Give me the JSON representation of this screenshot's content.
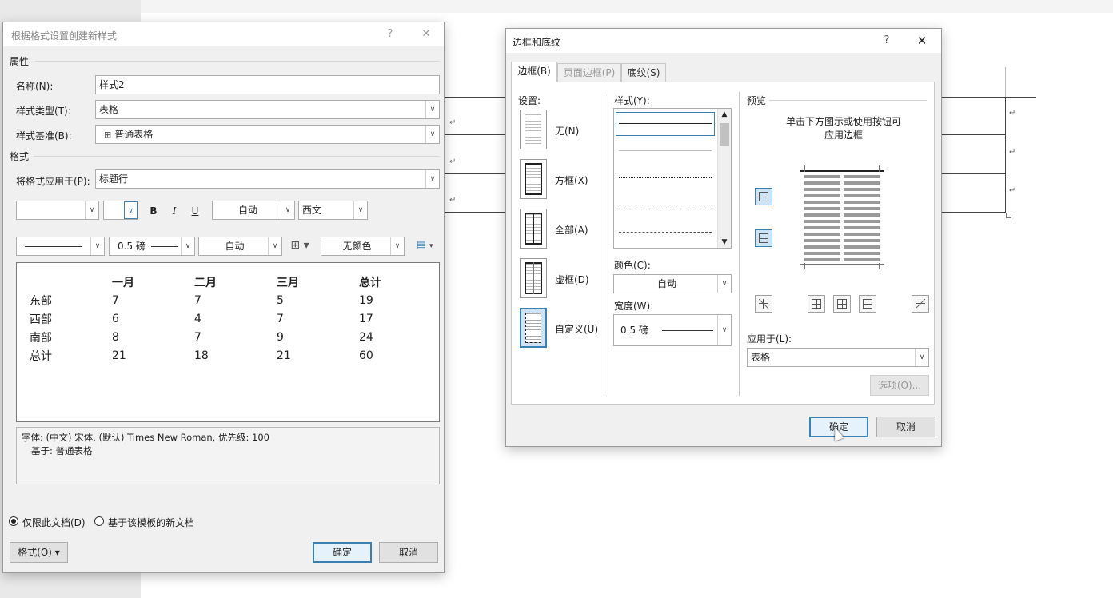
{
  "left_dialog": {
    "title": "根据格式设置创建新样式",
    "help": "?",
    "close": "✕",
    "section_properties": "属性",
    "name_label": "名称(N):",
    "name_value": "样式2",
    "type_label": "样式类型(T):",
    "type_value": "表格",
    "based_label": "样式基准(B):",
    "based_value": "普通表格",
    "section_format": "格式",
    "apply_label": "将格式应用于(P):",
    "apply_value": "标题行",
    "bold": "B",
    "italic": "I",
    "underline": "U",
    "font_color": "自动",
    "script": "西文",
    "border_weight": "0.5 磅",
    "border_color": "自动",
    "shading": "无颜色",
    "preview_table": {
      "headers": [
        "",
        "一月",
        "二月",
        "三月",
        "总计"
      ],
      "rows": [
        [
          "东部",
          "7",
          "7",
          "5",
          "19"
        ],
        [
          "西部",
          "6",
          "4",
          "7",
          "17"
        ],
        [
          "南部",
          "8",
          "7",
          "9",
          "24"
        ],
        [
          "总计",
          "21",
          "18",
          "21",
          "60"
        ]
      ]
    },
    "desc_line1": "字体: (中文) 宋体, (默认) Times New Roman, 优先级: 100",
    "desc_line2": "基于: 普通表格",
    "radio_doc": "仅限此文档(D)",
    "radio_template": "基于该模板的新文档",
    "format_button": "格式(O) ▾",
    "ok": "确定",
    "cancel": "取消"
  },
  "right_dialog": {
    "title": "边框和底纹",
    "help": "?",
    "close": "✕",
    "tabs": [
      "边框(B)",
      "页面边框(P)",
      "底纹(S)"
    ],
    "settings_label": "设置:",
    "settings": [
      "无(N)",
      "方框(X)",
      "全部(A)",
      "虚框(D)",
      "自定义(U)"
    ],
    "style_label": "样式(Y):",
    "color_label": "颜色(C):",
    "color_value": "自动",
    "width_label": "宽度(W):",
    "width_value": "0.5 磅",
    "preview_label": "预览",
    "preview_hint_1": "单击下方图示或使用按钮可",
    "preview_hint_2": "应用边框",
    "apply_label": "应用于(L):",
    "apply_value": "表格",
    "options": "选项(O)...",
    "ok": "确定",
    "cancel": "取消"
  },
  "document": {
    "para_mark": "↵"
  },
  "colors": {
    "accent": "#3c7fb1",
    "dialog_bg": "#f0f0f0"
  }
}
